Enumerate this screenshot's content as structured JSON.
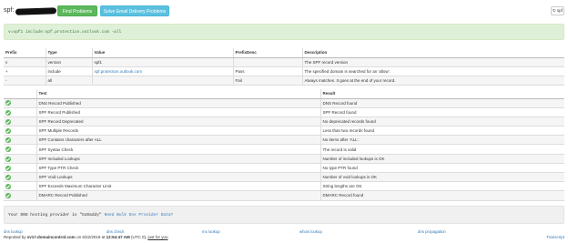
{
  "header": {
    "title": "spf:",
    "find_problems": "Find Problems",
    "solve_email": "Solve Email Delivery Problems",
    "refresh_label": "spf"
  },
  "record": {
    "text": "v=spf1 include:spf.protection.outlook.com -all"
  },
  "mechanisms": {
    "columns": [
      "Prefix",
      "Type",
      "Value",
      "PrefixDesc",
      "Description"
    ],
    "rows": [
      {
        "prefix": "v",
        "type": "version",
        "value": "spf1",
        "prefix_desc": "",
        "description": "The SPF record version"
      },
      {
        "prefix": "+",
        "type": "include",
        "value": "spf.protection.outlook.com",
        "prefix_desc": "Pass",
        "description": "The specified domain is searched for an 'allow'."
      },
      {
        "prefix": "-",
        "type": "all",
        "value": "",
        "prefix_desc": "Fail",
        "description": "Always matches. It goes at the end of your record."
      }
    ]
  },
  "tests": {
    "columns": [
      "",
      "Test",
      "Result"
    ],
    "rows": [
      {
        "test": "DNS Record Published",
        "result": "DNS Record found"
      },
      {
        "test": "SPF Record Published",
        "result": "SPF Record found"
      },
      {
        "test": "SPF Record Deprecated",
        "result": "No deprecated records found"
      },
      {
        "test": "SPF Multiple Records",
        "result": "Less than two records found"
      },
      {
        "test": "SPF Contains characters after ALL",
        "result": "No items after 'ALL'."
      },
      {
        "test": "SPF Syntax Check",
        "result": "The record is valid"
      },
      {
        "test": "SPF Included Lookups",
        "result": "Number of included lookups is OK"
      },
      {
        "test": "SPF Type PTR Check",
        "result": "No type PTR found"
      },
      {
        "test": "SPF Void Lookups",
        "result": "Number of void lookups is OK"
      },
      {
        "test": "SPF Exceeds Maximum Character Limit",
        "result": "String lengths are OK"
      },
      {
        "test": "DMARC Record Published",
        "result": "DMARC Record found"
      }
    ]
  },
  "provider": {
    "text": "Your DNS hosting provider is \"GoDaddy\"",
    "link": "Need Bulk Dns Provider Data?"
  },
  "footer": {
    "links": [
      "dns lookup",
      "dns check",
      "mx lookup",
      "whois lookup",
      "dns propagation"
    ],
    "reported_prefix": "Reported by",
    "server": "sv17.domaincontrol.com",
    "on": "on 6/22/2019 at",
    "time": "12:54:47 AM",
    "tz": "(UTC 0),",
    "just_for_you": "just for you",
    "transcript": "Transcript"
  },
  "colors": {
    "find_button": "#5cb85c",
    "solve_button": "#5bc0de",
    "record_bg": "#dff0d8",
    "check": "#5cb85c",
    "link": "#337ab7"
  }
}
